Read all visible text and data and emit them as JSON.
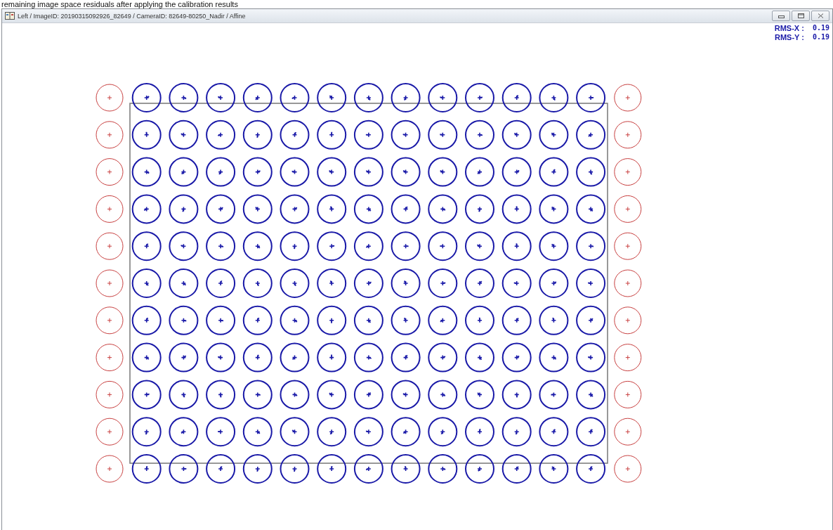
{
  "caption": "remaining image space residuals after applying the calibration results",
  "window": {
    "title": "Left / ImageID: 20190315092926_82649 / CameraID: 82649-80250_Nadir / Affine"
  },
  "rms": [
    {
      "label": "RMS-X :",
      "value": "0.19"
    },
    {
      "label": "RMS-Y :",
      "value": "0.19"
    }
  ],
  "target_columns": [
    {
      "kind": "excluded"
    },
    {
      "kind": "measured"
    },
    {
      "kind": "measured"
    },
    {
      "kind": "measured"
    },
    {
      "kind": "measured"
    },
    {
      "kind": "measured"
    },
    {
      "kind": "measured"
    },
    {
      "kind": "measured"
    },
    {
      "kind": "measured"
    },
    {
      "kind": "measured"
    },
    {
      "kind": "measured"
    },
    {
      "kind": "measured"
    },
    {
      "kind": "measured"
    },
    {
      "kind": "measured"
    },
    {
      "kind": "excluded"
    }
  ]
}
